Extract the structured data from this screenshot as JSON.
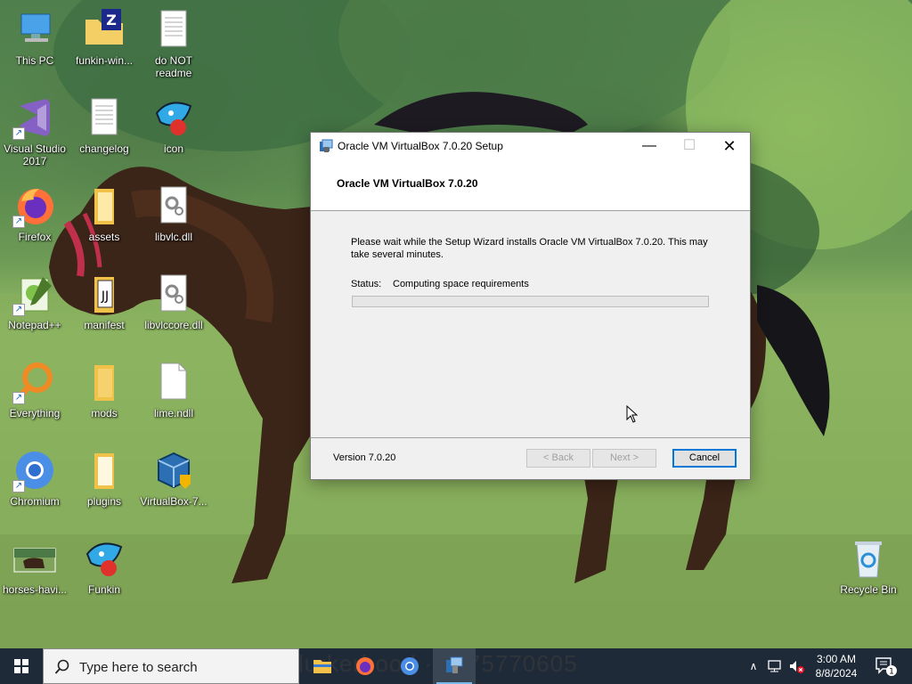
{
  "desktop": {
    "icons": [
      {
        "label": "This PC",
        "icon": "computer-icon"
      },
      {
        "label": "funkin-win...",
        "icon": "zip-folder-icon"
      },
      {
        "label": "do NOT\nreadme",
        "icon": "text-file-icon"
      },
      {
        "label": "Visual Studio\n2017",
        "icon": "visual-studio-icon"
      },
      {
        "label": "changelog",
        "icon": "text-file-icon"
      },
      {
        "label": "icon",
        "icon": "funkin-character-icon"
      },
      {
        "label": "Firefox",
        "icon": "firefox-icon"
      },
      {
        "label": "assets",
        "icon": "folder-icon"
      },
      {
        "label": "libvlc.dll",
        "icon": "dll-file-icon"
      },
      {
        "label": "Notepad++",
        "icon": "notepadpp-icon"
      },
      {
        "label": "manifest",
        "icon": "folder-icon"
      },
      {
        "label": "libvlccore.dll",
        "icon": "dll-file-icon"
      },
      {
        "label": "Everything",
        "icon": "search-app-icon"
      },
      {
        "label": "mods",
        "icon": "folder-icon"
      },
      {
        "label": "lime.ndll",
        "icon": "blank-file-icon"
      },
      {
        "label": "Chromium",
        "icon": "chromium-icon"
      },
      {
        "label": "plugins",
        "icon": "folder-icon"
      },
      {
        "label": "VirtualBox-7...",
        "icon": "virtualbox-installer-icon"
      },
      {
        "label": "horses-havi...",
        "icon": "image-file-icon"
      },
      {
        "label": "Funkin",
        "icon": "funkin-character-icon"
      },
      {
        "label": "Recycle Bin",
        "icon": "recycle-bin-icon"
      }
    ]
  },
  "window": {
    "title": "Oracle VM VirtualBox 7.0.20 Setup",
    "header_title": "Oracle VM VirtualBox 7.0.20",
    "wait_text": "Please wait while the Setup Wizard installs Oracle VM VirtualBox 7.0.20. This may take several minutes.",
    "status_label": "Status:",
    "status_value": "Computing space requirements",
    "progress_fraction": 0.0,
    "version_text": "Version 7.0.20",
    "back_label": "< Back",
    "next_label": "Next >",
    "cancel_label": "Cancel",
    "min_glyph": "—",
    "max_glyph": "☐",
    "close_glyph": "✕"
  },
  "taskbar": {
    "search_placeholder": "Type here to search",
    "watermark": "lurkerhood · 1075770605",
    "apps": [
      "file-explorer-icon",
      "firefox-icon",
      "chromium-icon",
      "virtualbox-setup-icon"
    ],
    "tray_arrow": "∧",
    "time": "3:00 AM",
    "date": "8/8/2024",
    "notification_count": "1"
  },
  "colors": {
    "accent": "#0078d7",
    "taskbar": "#1f2a38",
    "progress_fill": "#06b025"
  }
}
